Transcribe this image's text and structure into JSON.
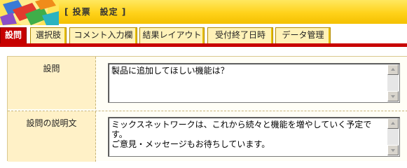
{
  "header": {
    "title": "[ 投票　設定 ]",
    "logo_icon": "colorful-books-logo-icon"
  },
  "tabs": [
    {
      "label": "設問",
      "active": true
    },
    {
      "label": "選択肢",
      "active": false
    },
    {
      "label": "コメント入力欄",
      "active": false
    },
    {
      "label": "結果レイアウト",
      "active": false
    },
    {
      "label": "受付終了日時",
      "active": false
    },
    {
      "label": "データ管理",
      "active": false
    }
  ],
  "form": {
    "question": {
      "label": "設問",
      "value": "製品に追加してほしい機能は？"
    },
    "description": {
      "label": "設問の説明文",
      "value": "ミックスネットワークは、これから続々と機能を増やしていく予定です。\nご意見・メッセージもお待ちしています。"
    }
  },
  "colors": {
    "header": "#ffd21a",
    "active_tab": "#c60000",
    "tab": "#fff2b8",
    "label_bg": "#fff1c7"
  }
}
